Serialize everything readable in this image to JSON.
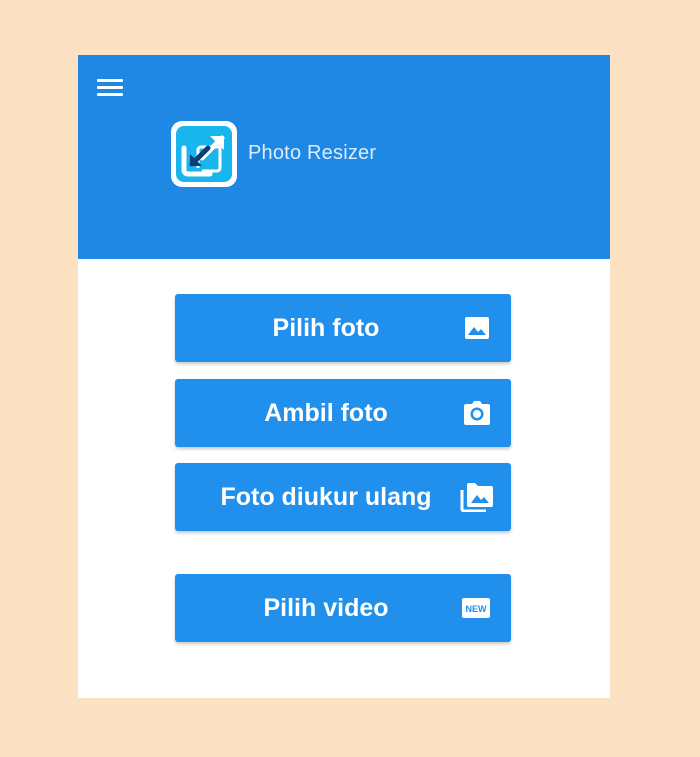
{
  "app": {
    "title": "Photo Resizer"
  },
  "icons": {
    "menu": "menu-icon",
    "logo": "resize-arrows-icon",
    "pick_photo": "image-icon",
    "take_photo": "camera-icon",
    "resized_photos": "photo-library-icon",
    "pick_video": "new-badge-icon"
  },
  "buttons": {
    "pick_photo": "Pilih foto",
    "take_photo": "Ambil foto",
    "resized_photos": "Foto diukur ulang",
    "pick_video": "Pilih video",
    "new_badge": "NEW"
  },
  "colors": {
    "page_background": "#fde1c3",
    "appbar": "#1f88e5",
    "button": "#2190ec",
    "title_text": "#dcecfb"
  }
}
